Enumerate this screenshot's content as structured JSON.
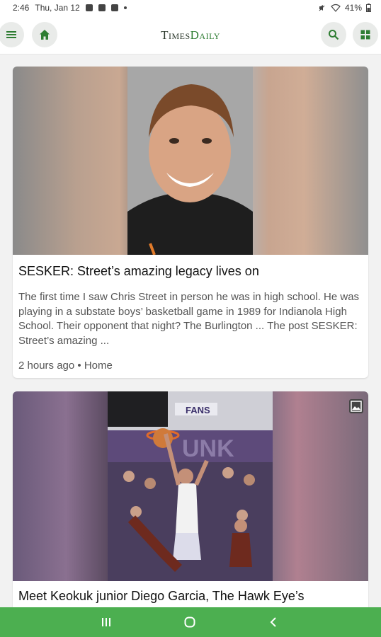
{
  "status": {
    "time": "2:46",
    "date": "Thu, Jan 12",
    "battery": "41%"
  },
  "header": {
    "logo_main": "Times",
    "logo_accent": "Daily",
    "icons": {
      "menu": "menu-icon",
      "home": "home-icon",
      "search": "search-icon",
      "sections": "grid-icon"
    }
  },
  "colors": {
    "brand_green": "#4caf50",
    "icon_green": "#2e7d32",
    "header_button_bg": "#e9ebe9"
  },
  "articles": [
    {
      "title": "SESKER: Street’s amazing legacy lives on",
      "excerpt": "The first time I saw Chris Street in person he was in high school. He was playing in a substate boys’ basketball game in 1989 for Indianola High School. Their opponent that night? The Burlington ... The post SESKER: Street’s amazing ...",
      "time_ago": "2 hours ago",
      "separator": "•",
      "section": "Home"
    },
    {
      "title": "Meet Keokuk junior Diego Garcia, The Hawk Eye’s",
      "has_gallery_badge": true,
      "photo_signs": {
        "banner": "FANS",
        "wall_text": "UNK"
      }
    }
  ]
}
